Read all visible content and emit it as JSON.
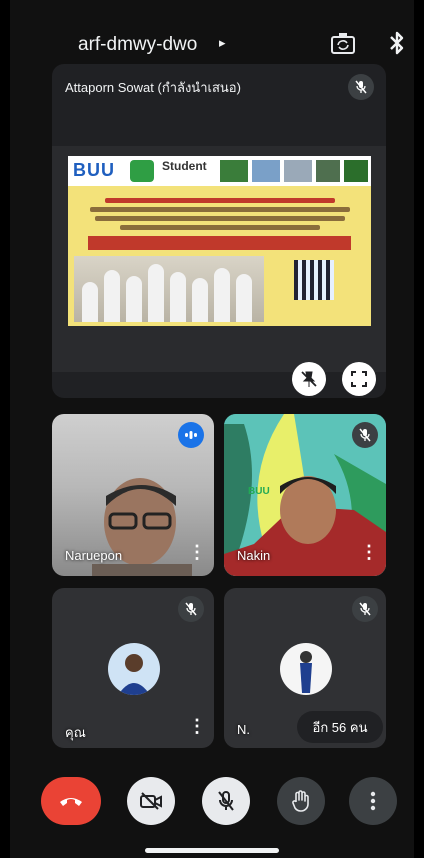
{
  "header": {
    "meeting_code": "arf-dmwy-dwo",
    "chevron": "▸",
    "camera_switch_icon": "camera-switch-icon",
    "bluetooth_icon": "bluetooth-icon"
  },
  "presenter": {
    "name": "Attaporn Sowat (กำลังนำเสนอ)",
    "mic_icon": "mic-off-icon",
    "slide": {
      "logo_text": "BUU",
      "student_text": "Student"
    },
    "unpin_icon": "unpin-icon",
    "fullscreen_icon": "fullscreen-icon"
  },
  "participants": [
    {
      "name": "Naruepon",
      "status_icon": "speaking-indicator-icon",
      "menu": "⋮"
    },
    {
      "name": "Nakin",
      "status_icon": "mic-off-icon",
      "menu": "⋮"
    },
    {
      "name": "คุณ",
      "status_icon": "mic-off-icon",
      "menu": "⋮"
    },
    {
      "name": "N.",
      "status_icon": "mic-off-icon",
      "more_label": "อีก 56 คน"
    }
  ],
  "controls": [
    {
      "label": "end-call",
      "icon": "phone-hangup-icon",
      "color": "#ea4335"
    },
    {
      "label": "camera",
      "icon": "camera-off-icon",
      "color": "#e8eaed"
    },
    {
      "label": "microphone",
      "icon": "mic-off-icon",
      "color": "#e8eaed"
    },
    {
      "label": "raise-hand",
      "icon": "hand-icon",
      "color": "#3c4043"
    },
    {
      "label": "more-options",
      "icon": "more-vert-icon",
      "color": "#3c4043"
    }
  ],
  "colors": {
    "background": "#111111",
    "tile": "#303134",
    "accent_blue": "#1a73e8",
    "end_call_red": "#ea4335"
  }
}
